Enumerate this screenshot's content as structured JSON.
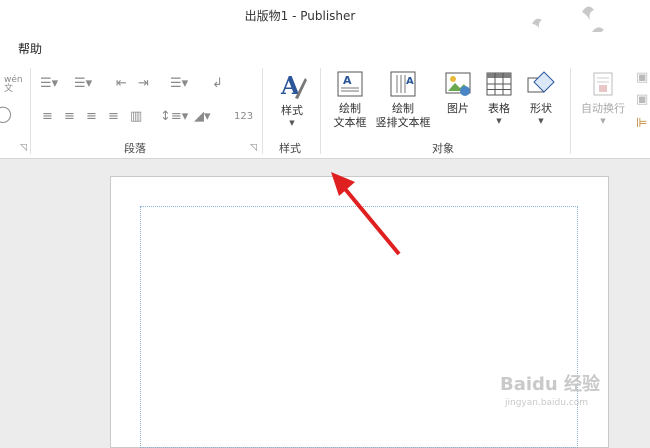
{
  "window": {
    "title": "出版物1  -  Publisher"
  },
  "menubar": {
    "help": "帮助"
  },
  "ribbon": {
    "paragraph_group": {
      "label": "段落",
      "pinyin_icon": "wén\n文",
      "numbering_text": "123"
    },
    "styles_group": {
      "label": "样式",
      "styles_button": "样式"
    },
    "objects_group": {
      "label": "对象",
      "draw_textbox": "绘制\n文本框",
      "draw_vertical_textbox": "绘制\n竖排文本框",
      "picture": "图片",
      "table": "表格",
      "shapes": "形状"
    },
    "auto_wrap": "自动换行"
  },
  "watermark": {
    "brand": "Baidu 经验",
    "url": "jingyan.baidu.com"
  },
  "colors": {
    "accent": "#2b579a",
    "arrow": "#e02020"
  }
}
